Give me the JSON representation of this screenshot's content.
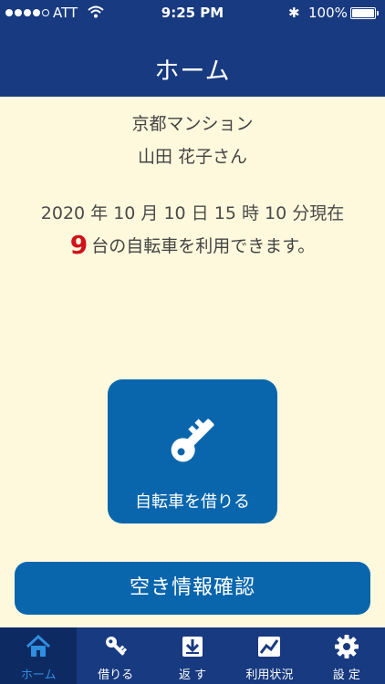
{
  "status_bar": {
    "carrier": "ATT",
    "time": "9:25 PM",
    "bluetooth": "✱",
    "battery": "100%"
  },
  "header": {
    "title": "ホーム"
  },
  "info": {
    "building": "京都マンション",
    "user": "山田 花子さん",
    "timestamp": "2020 年 10 月 10 日 15 時 10 分現在",
    "available_count": "9",
    "available_suffix": "台の自転車を利用できます。"
  },
  "actions": {
    "rent_label": "自転車を借りる",
    "vacancy_label": "空き情報確認"
  },
  "tabs": [
    {
      "label": "ホーム",
      "icon": "home-icon",
      "active": true
    },
    {
      "label": "借りる",
      "icon": "key-icon",
      "active": false
    },
    {
      "label": "返 す",
      "icon": "return-icon",
      "active": false
    },
    {
      "label": "利用状況",
      "icon": "chart-icon",
      "active": false
    },
    {
      "label": "設 定",
      "icon": "gear-icon",
      "active": false
    }
  ],
  "colors": {
    "header": "#183a80",
    "background": "#fef9dd",
    "button": "#0966ad",
    "count": "#d0121b",
    "tab_active": "#2f8ee0"
  }
}
